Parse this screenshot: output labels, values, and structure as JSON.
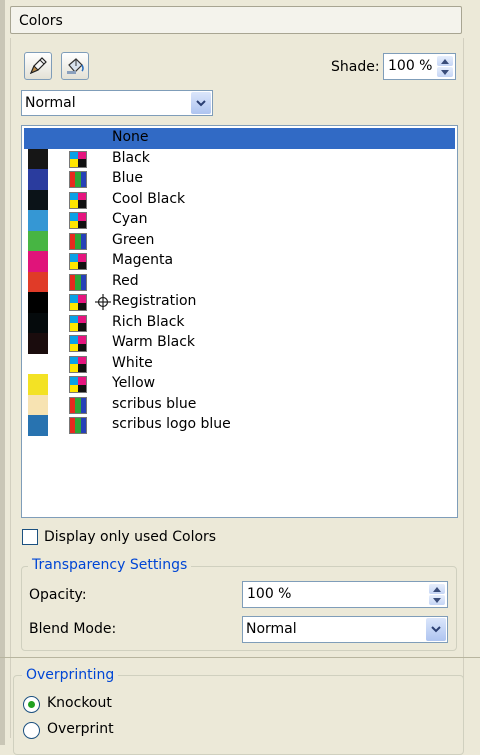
{
  "panel": {
    "title": "Colors"
  },
  "toolbar": {
    "edit_icon": "pen-icon",
    "fill_icon": "paint-bucket-icon"
  },
  "shade": {
    "label": "Shade:",
    "value": "100 %"
  },
  "mode": {
    "value": "Normal"
  },
  "colors": [
    {
      "name": "None",
      "swatch": null,
      "model": "none",
      "selected": true
    },
    {
      "name": "Black",
      "swatch": "#161616",
      "model": "cmyk"
    },
    {
      "name": "Blue",
      "swatch": "#2a3c9e",
      "model": "rgb"
    },
    {
      "name": "Cool Black",
      "swatch": "#0b1318",
      "model": "cmyk"
    },
    {
      "name": "Cyan",
      "swatch": "#3597d4",
      "model": "cmyk"
    },
    {
      "name": "Green",
      "swatch": "#47b543",
      "model": "rgb"
    },
    {
      "name": "Magenta",
      "swatch": "#e0147a",
      "model": "cmyk"
    },
    {
      "name": "Red",
      "swatch": "#e03b28",
      "model": "rgb"
    },
    {
      "name": "Registration",
      "swatch": "#000000",
      "model": "cmyk",
      "registration": true
    },
    {
      "name": "Rich Black",
      "swatch": "#050a0c",
      "model": "cmyk"
    },
    {
      "name": "Warm Black",
      "swatch": "#1a0c0d",
      "model": "cmyk"
    },
    {
      "name": "White",
      "swatch": "#ffffff",
      "model": "cmyk"
    },
    {
      "name": "Yellow",
      "swatch": "#f3e224",
      "model": "cmyk"
    },
    {
      "name": "scribus blue",
      "swatch": "#f7e3b2",
      "model": "rgb"
    },
    {
      "name": "scribus logo blue",
      "swatch": "#2873b0",
      "model": "rgb"
    }
  ],
  "display_used": {
    "label": "Display only used Colors",
    "checked": false
  },
  "transparency": {
    "title": "Transparency Settings",
    "opacity_label": "Opacity:",
    "opacity_value": "100 %",
    "blend_label": "Blend Mode:",
    "blend_value": "Normal"
  },
  "overprinting": {
    "title": "Overprinting",
    "options": [
      {
        "label": "Knockout",
        "checked": true
      },
      {
        "label": "Overprint",
        "checked": false
      }
    ]
  },
  "accent": {
    "selection": "#316ac5",
    "group_title": "#0046d5",
    "radio_dot": "#21a121"
  }
}
